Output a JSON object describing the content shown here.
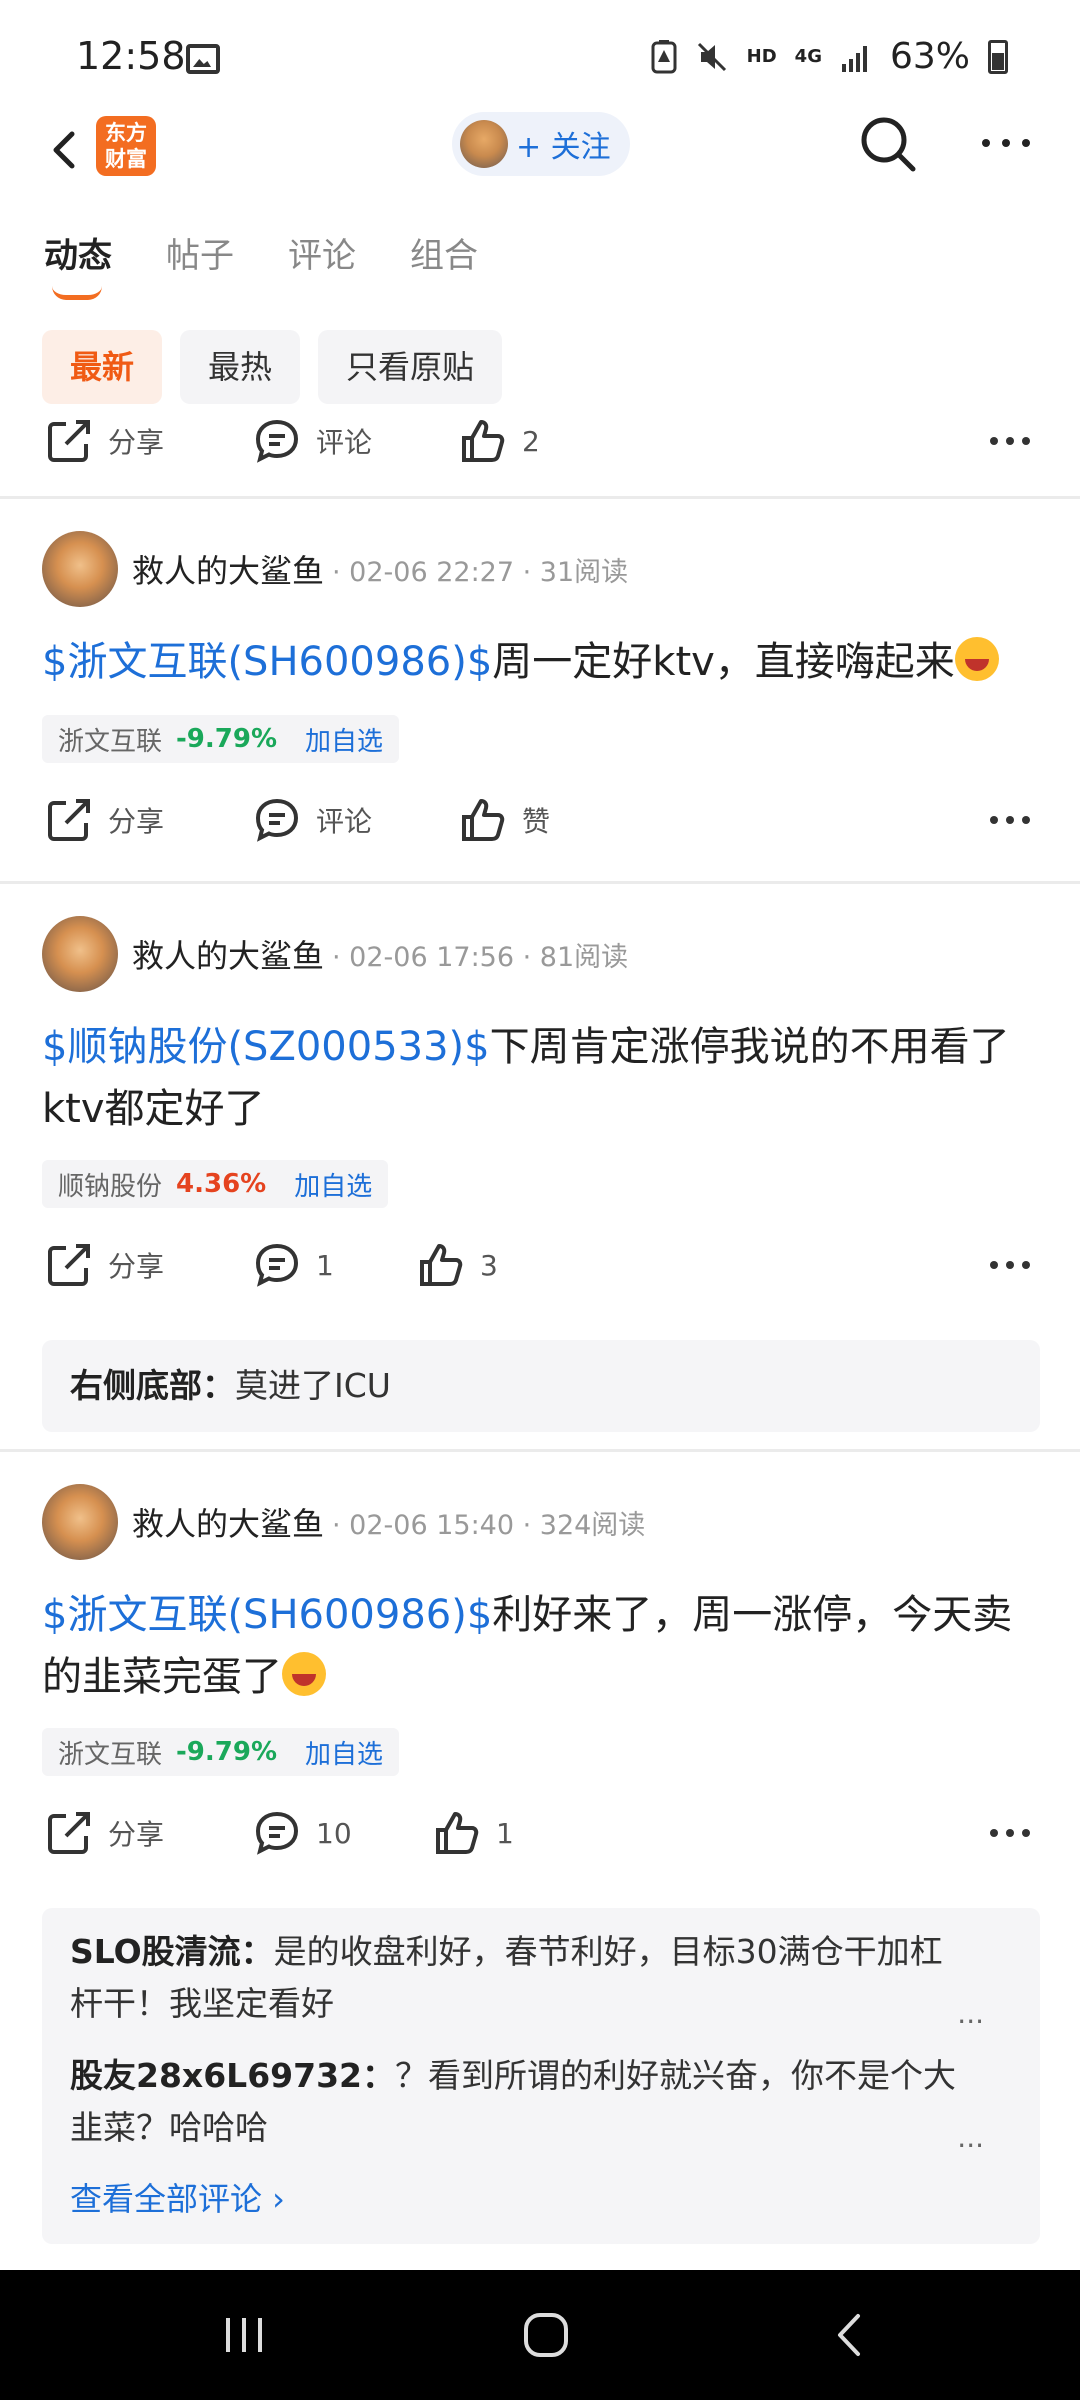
{
  "status_bar": {
    "time": "12:58",
    "network_hd": "HD",
    "network_4g": "4G",
    "battery": "63%"
  },
  "header": {
    "logo_text": "东方财富",
    "follow_label": "+ 关注"
  },
  "tabs": [
    {
      "label": "动态",
      "active": true
    },
    {
      "label": "帖子"
    },
    {
      "label": "评论"
    },
    {
      "label": "组合"
    }
  ],
  "filters": [
    {
      "label": "最新",
      "active": true
    },
    {
      "label": "最热"
    },
    {
      "label": "只看原贴"
    }
  ],
  "top_actions": {
    "share": "分享",
    "comment": "评论",
    "like": "2"
  },
  "posts": [
    {
      "author": "救人的大鲨鱼",
      "meta": "· 02-06 22:27 · 31阅读",
      "stock_link": "$浙文互联(SH600986)$",
      "text": "周一定好ktv，直接嗨起来",
      "emoji": "laughing-face",
      "tag": {
        "name": "浙文互联",
        "change": "-9.79%",
        "direction": "down",
        "add": "加自选"
      },
      "actions": {
        "share": "分享",
        "comment": "评论",
        "like": "赞"
      }
    },
    {
      "author": "救人的大鲨鱼",
      "meta": "· 02-06 17:56 · 81阅读",
      "stock_link": "$顺钠股份(SZ000533)$",
      "text": "下周肯定涨停我说的不用看了ktv都定好了",
      "tag": {
        "name": "顺钠股份",
        "change": "4.36%",
        "direction": "up",
        "add": "加自选"
      },
      "actions": {
        "share": "分享",
        "comment": "1",
        "like": "3"
      },
      "comments": [
        {
          "user": "右侧底部：",
          "text": "莫进了ICU"
        }
      ]
    },
    {
      "author": "救人的大鲨鱼",
      "meta": "· 02-06 15:40 · 324阅读",
      "stock_link": "$浙文互联(SH600986)$",
      "text": "利好来了，周一涨停，今天卖的韭菜完蛋了",
      "emoji": "laughing-face",
      "tag": {
        "name": "浙文互联",
        "change": "-9.79%",
        "direction": "down",
        "add": "加自选"
      },
      "actions": {
        "share": "分享",
        "comment": "10",
        "like": "1"
      },
      "comments": [
        {
          "user": "SLO股清流：",
          "text": "是的收盘利好，春节利好，目标30满仓干加杠杆干！我坚定看好"
        },
        {
          "user": "股友28x6L69732：",
          "text": "？看到所谓的利好就兴奋，你不是个大韭菜？哈哈哈"
        }
      ],
      "see_all": "查看全部评论 ›"
    }
  ],
  "colors": {
    "accent": "#f36d21",
    "link": "#1d6fd8",
    "down": "#1aa85a",
    "up": "#e5431f"
  }
}
